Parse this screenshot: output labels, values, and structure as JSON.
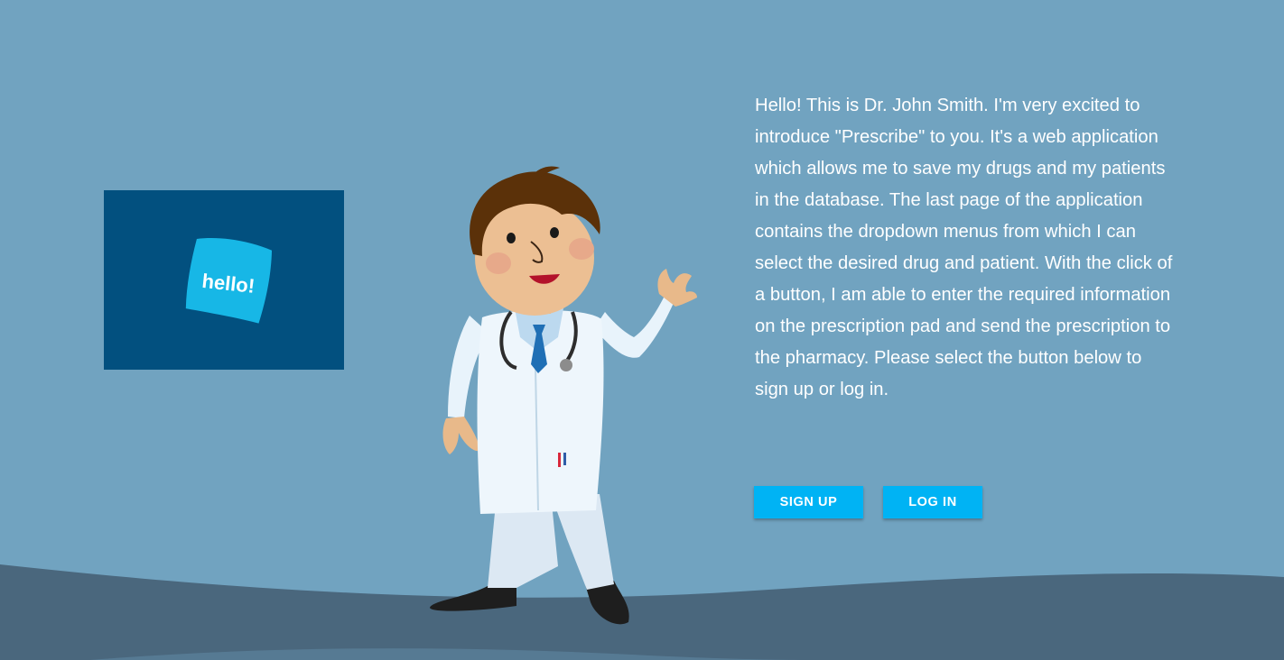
{
  "colors": {
    "background": "#71a3c0",
    "ground": "#4a677d",
    "video_card": "#02507f",
    "badge": "#17b7e6",
    "button": "#00b3f4"
  },
  "video": {
    "badge_text": "hello!"
  },
  "intro": {
    "text": "Hello! This is Dr. John Smith. I'm very excited to introduce \"Prescribe\" to you. It's a web application which allows me to save my drugs and my patients in the database. The last page of the application contains the dropdown menus from which I can select the desired drug and patient. With the click of a button, I am able to enter the required information on the prescription pad and send the prescription to the pharmacy. Please select the button below to sign up or log in."
  },
  "actions": {
    "signup_label": "SIGN UP",
    "login_label": "LOG IN"
  },
  "illustration": {
    "icon": "doctor-waving-icon"
  }
}
